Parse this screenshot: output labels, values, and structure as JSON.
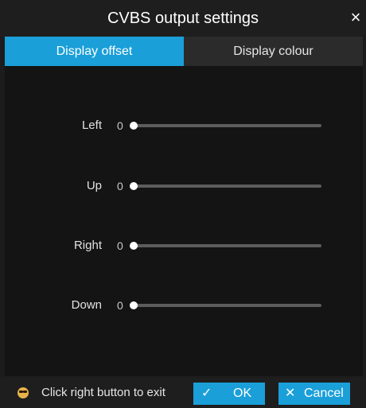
{
  "dialog": {
    "title": "CVBS output settings",
    "close_glyph": "×"
  },
  "tabs": [
    {
      "label": "Display offset",
      "active": true
    },
    {
      "label": "Display colour",
      "active": false
    }
  ],
  "offsets": [
    {
      "label": "Left",
      "value": "0",
      "level": 0
    },
    {
      "label": "Up",
      "value": "0",
      "level": 0
    },
    {
      "label": "Right",
      "value": "0",
      "level": 0
    },
    {
      "label": "Down",
      "value": "0",
      "level": 0
    }
  ],
  "footer": {
    "hint_icon": "mouse-icon",
    "hint": "Click right button to exit",
    "ok_glyph": "✓",
    "ok_label": "OK",
    "cancel_glyph": "✕",
    "cancel_label": "Cancel"
  },
  "colors": {
    "accent": "#1a9fd9",
    "background": "#141414"
  }
}
